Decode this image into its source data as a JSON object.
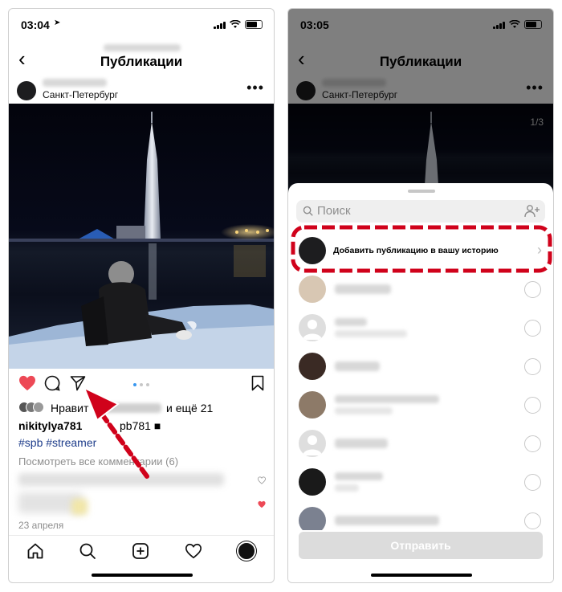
{
  "left_screen": {
    "status": {
      "time": "03:04"
    },
    "nav": {
      "title": "Публикации"
    },
    "post": {
      "location": "Санкт-Петербург",
      "likes": {
        "prefix": "Нравит",
        "suffix": "и ещё 21"
      },
      "caption_user": "nikitylya781",
      "caption_fragment": "pb781 ■",
      "hashtags": "#spb #streamer",
      "view_comments": "Посмотреть все комментарии (6)",
      "date": "23 апреля"
    },
    "tabbar": [
      "home-icon",
      "search-icon",
      "add-icon",
      "heart-icon",
      "profile-avatar"
    ]
  },
  "right_screen": {
    "status": {
      "time": "03:05"
    },
    "nav": {
      "title": "Публикации",
      "location": "Санкт-Петербург",
      "counter": "1/3"
    },
    "share_sheet": {
      "search_placeholder": "Поиск",
      "story_option": "Добавить публикацию в вашу историю",
      "send_button": "Отправить"
    }
  },
  "colors": {
    "like_red": "#ed4956",
    "highlight_red": "#d0021b",
    "hashtag_blue": "#1e3d8b",
    "muted_gray": "#8e8e8e"
  }
}
